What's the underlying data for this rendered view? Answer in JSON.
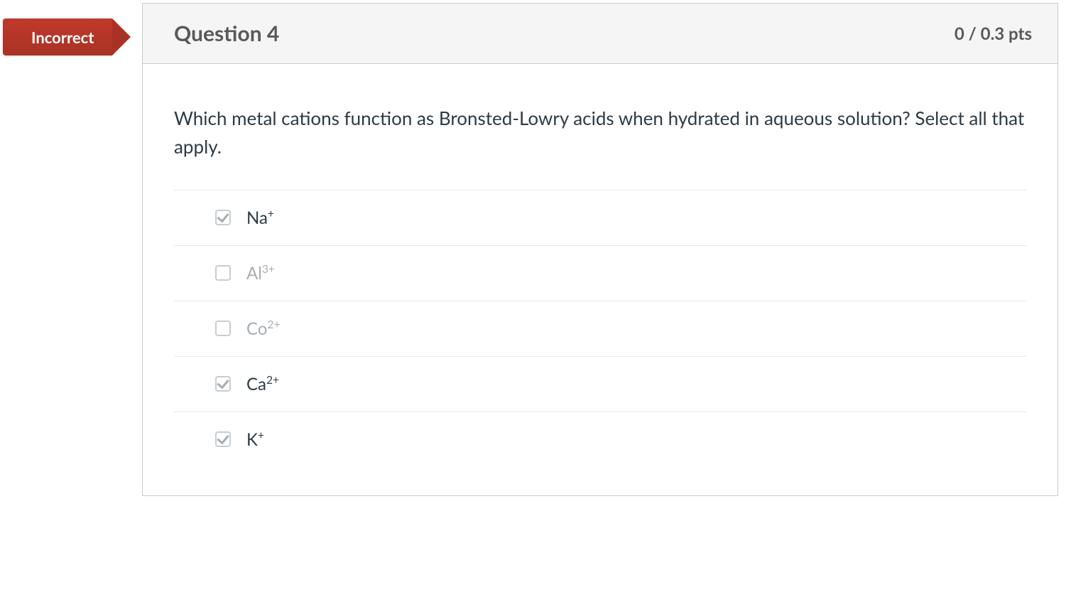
{
  "status_label": "Incorrect",
  "header": {
    "title": "Question 4",
    "points": "0 / 0.3 pts"
  },
  "prompt": "Which metal cations function as Bronsted-Lowry acids when hydrated in aqueous solution? Select all that apply.",
  "answers": [
    {
      "base": "Na",
      "sup": "+",
      "checked": true
    },
    {
      "base": "Al",
      "sup": "3+",
      "checked": false
    },
    {
      "base": "Co",
      "sup": "2+",
      "checked": false
    },
    {
      "base": "Ca",
      "sup": "2+",
      "checked": true
    },
    {
      "base": "K",
      "sup": "+",
      "checked": true
    }
  ]
}
